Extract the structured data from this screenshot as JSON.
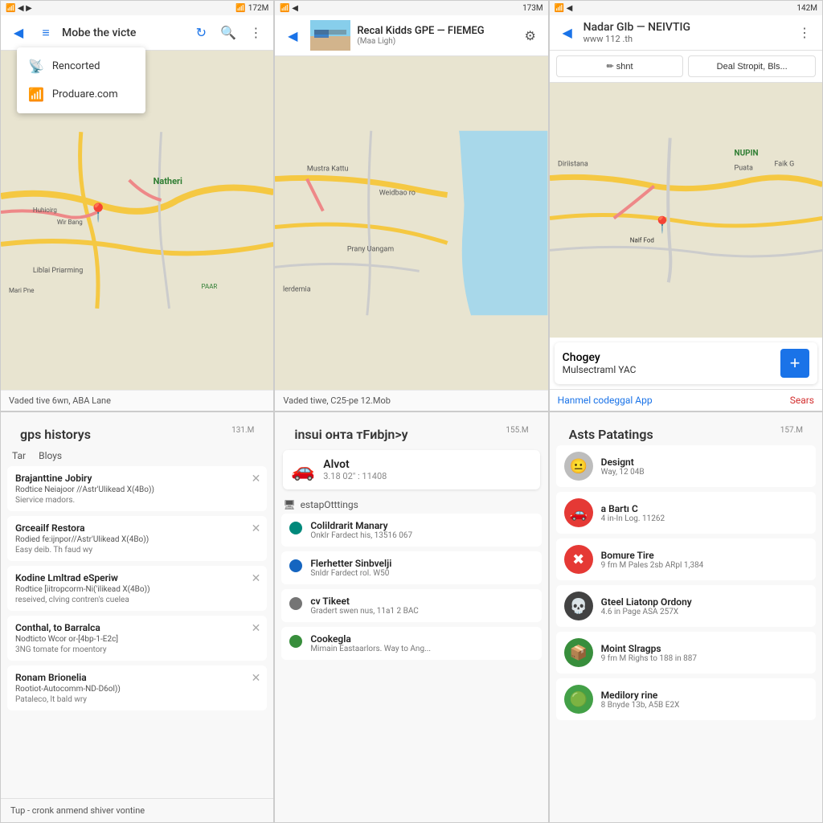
{
  "panels": {
    "top_left": {
      "status": {
        "left": "📶 ◀",
        "battery": "172M"
      },
      "title": "Mobe the victe",
      "icons": [
        "refresh",
        "search",
        "more"
      ],
      "dropdown": {
        "items": [
          {
            "icon": "📡",
            "label": "Rencorted"
          },
          {
            "icon": "📶",
            "label": "Produare.com"
          }
        ]
      },
      "map_label": "Natheri",
      "footer": "Vaded tive 6wn, ABA Lane"
    },
    "top_mid": {
      "status": {
        "battery": "173M"
      },
      "thumb_title": "Recal Kidds GPE — FIEМEG",
      "thumb_sub": "(Maa Ligh)",
      "icon": "gear",
      "footer": "Vaded tiwe, C25-pe 12.Mob"
    },
    "top_right": {
      "status": {
        "battery": "142M"
      },
      "title": "Nadar GIb — NЕIVTIG",
      "sub": "www 112 .th",
      "btn1": "✏ shnt",
      "btn2": "Deal Stropit, Bls...",
      "info_card": {
        "title": "Chogey",
        "sub": "Mulsectraml YAC"
      },
      "link_blue": "Hanmel codeggal App",
      "link_red": "Sears",
      "footer": ""
    },
    "bottom_left": {
      "header_accent": "gps",
      "header_rest": " historys",
      "storage": "131.M",
      "tabs": [
        "Tar",
        "Bloys"
      ],
      "items": [
        {
          "title": "Brajanttine Jobiry",
          "sub": "Rodtice Neiajoor //Astr'Ulikead X(4Bo))",
          "desc": "Siervice madors."
        },
        {
          "title": "Grceailf Restora",
          "sub": "Rodied fe:ijnpor//Astr'Ulikead X(4Bo))",
          "desc": "Easy deib. Th faud wy"
        },
        {
          "title": "Kodine Lmltrad eSperiw",
          "sub": "Rodtice [iitropcorm-Ni('ilikead X(4Bo))",
          "desc": "reseived, clving contren's cuelea"
        },
        {
          "title": "Conthal, to Barralca",
          "sub": "Nodticto Wcor or-[4bp-1-E2c]",
          "desc": "3NG tomate for moentory"
        },
        {
          "title": "Ronam Brionelia",
          "sub": "Rootiot-Autocomm-ND-D6ol))",
          "desc": "Pataleco, lt bald wry"
        }
      ],
      "footer": "Tup - cronk anmend shiver vontine"
    },
    "bottom_mid": {
      "header_accent": "i",
      "header_rest": "nsui онта тFиbjn>y",
      "storage": "155.M",
      "alert": {
        "icon": "🚗",
        "title": "Alvot",
        "sub": "3.18 02\" : 11408"
      },
      "settings_label": "estapOtttings",
      "items": [
        {
          "dot": "teal",
          "title": "Colildrarit Manary",
          "sub": "Onklr Fardect his, 13516 067"
        },
        {
          "dot": "blue",
          "title": "Flerhetter Sinbvelji",
          "sub": "Snldr Fardect rol. W50"
        },
        {
          "dot": "gray",
          "title": "cv Tikeet",
          "sub": "Gradert swen nus, 11a1 2 BAC"
        },
        {
          "dot": "green",
          "title": "Cookegla",
          "sub": "Mimain Eastaarlors. Way to Ang..."
        }
      ]
    },
    "bottom_right": {
      "header_accent": "A",
      "header_rest": "sts Patatings",
      "storage": "157.M",
      "items": [
        {
          "avatar": "gray",
          "avatar_icon": "😐",
          "title": "Designt",
          "sub": "Way, 12 04B"
        },
        {
          "avatar": "red",
          "avatar_icon": "🚗",
          "title": "a Bartı C",
          "sub": "4 in-In Log. 11262"
        },
        {
          "avatar": "red-x",
          "avatar_icon": "✖",
          "title": "Bomure Tire",
          "sub": "9 fm M Pales 2sb ARpl 1,384"
        },
        {
          "avatar": "dark",
          "avatar_icon": "💀",
          "title": "Gteel Liatonp Ordony",
          "sub": "4.6 in Page ASA 257X"
        },
        {
          "avatar": "green",
          "avatar_icon": "📦",
          "title": "Moint Slragps",
          "sub": "9 fm M Righs to 188 in 887"
        },
        {
          "avatar": "green2",
          "avatar_icon": "🟢",
          "title": "Medilory rine",
          "sub": "8 Bnyde 13b, A5B  E2X"
        }
      ]
    }
  }
}
